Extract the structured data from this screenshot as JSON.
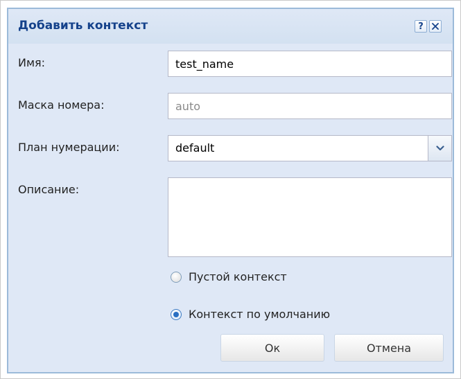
{
  "dialog": {
    "title": "Добавить контекст",
    "help_icon": "question-icon",
    "close_icon": "close-icon"
  },
  "form": {
    "name_label": "Имя:",
    "name_value": "test_name",
    "mask_label": "Маска номера:",
    "mask_placeholder": "auto",
    "plan_label": "План нумерации:",
    "plan_value": "default",
    "description_label": "Описание:",
    "description_value": ""
  },
  "radios": [
    {
      "label": "Пустой контекст",
      "checked": false
    },
    {
      "label": "Контекст по умолчанию",
      "checked": true
    }
  ],
  "buttons": {
    "ok_label": "Ок",
    "cancel_label": "Отмена"
  },
  "colors": {
    "title": "#15428b",
    "dialog_bg": "#dfe8f6",
    "dialog_border": "#9bbad9",
    "radio_accent": "#2a6fc2"
  }
}
